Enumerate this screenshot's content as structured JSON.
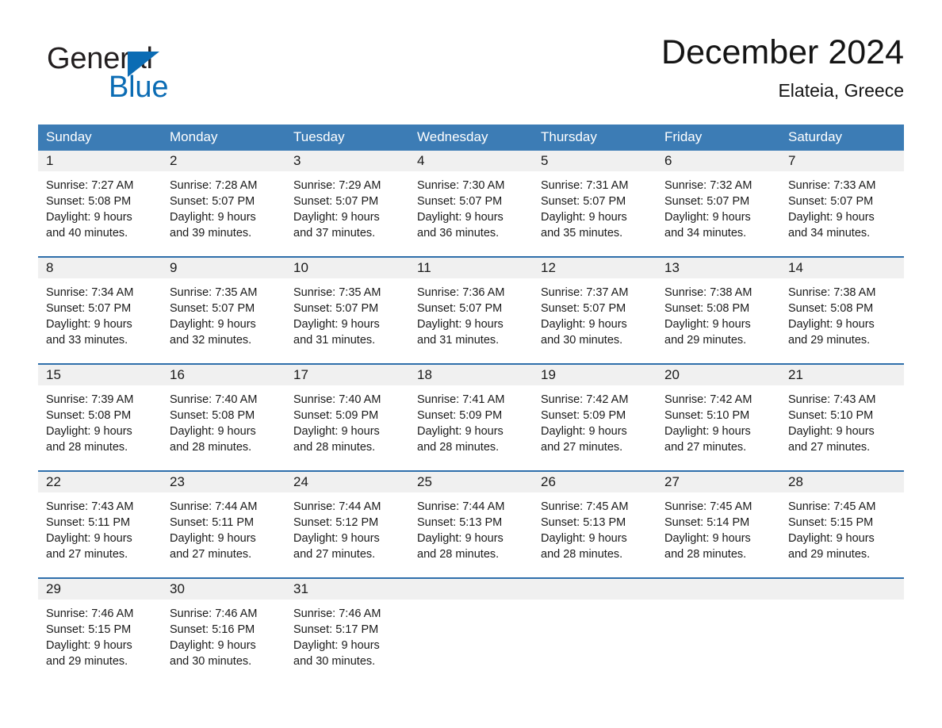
{
  "brand": {
    "name_part1": "General",
    "name_part2": "Blue",
    "accent_color": "#0b6cb4"
  },
  "header": {
    "month_title": "December 2024",
    "location": "Elateia, Greece"
  },
  "theme": {
    "header_row_color": "#3c7cb5",
    "week_separator_color": "#2f6fab",
    "daynum_band_color": "#f0f0f0",
    "page_background": "#ffffff"
  },
  "calendar": {
    "weekday_headers": [
      "Sunday",
      "Monday",
      "Tuesday",
      "Wednesday",
      "Thursday",
      "Friday",
      "Saturday"
    ],
    "weeks": [
      [
        {
          "day": "1",
          "sunrise": "Sunrise: 7:27 AM",
          "sunset": "Sunset: 5:08 PM",
          "daylight_line1": "Daylight: 9 hours",
          "daylight_line2": "and 40 minutes."
        },
        {
          "day": "2",
          "sunrise": "Sunrise: 7:28 AM",
          "sunset": "Sunset: 5:07 PM",
          "daylight_line1": "Daylight: 9 hours",
          "daylight_line2": "and 39 minutes."
        },
        {
          "day": "3",
          "sunrise": "Sunrise: 7:29 AM",
          "sunset": "Sunset: 5:07 PM",
          "daylight_line1": "Daylight: 9 hours",
          "daylight_line2": "and 37 minutes."
        },
        {
          "day": "4",
          "sunrise": "Sunrise: 7:30 AM",
          "sunset": "Sunset: 5:07 PM",
          "daylight_line1": "Daylight: 9 hours",
          "daylight_line2": "and 36 minutes."
        },
        {
          "day": "5",
          "sunrise": "Sunrise: 7:31 AM",
          "sunset": "Sunset: 5:07 PM",
          "daylight_line1": "Daylight: 9 hours",
          "daylight_line2": "and 35 minutes."
        },
        {
          "day": "6",
          "sunrise": "Sunrise: 7:32 AM",
          "sunset": "Sunset: 5:07 PM",
          "daylight_line1": "Daylight: 9 hours",
          "daylight_line2": "and 34 minutes."
        },
        {
          "day": "7",
          "sunrise": "Sunrise: 7:33 AM",
          "sunset": "Sunset: 5:07 PM",
          "daylight_line1": "Daylight: 9 hours",
          "daylight_line2": "and 34 minutes."
        }
      ],
      [
        {
          "day": "8",
          "sunrise": "Sunrise: 7:34 AM",
          "sunset": "Sunset: 5:07 PM",
          "daylight_line1": "Daylight: 9 hours",
          "daylight_line2": "and 33 minutes."
        },
        {
          "day": "9",
          "sunrise": "Sunrise: 7:35 AM",
          "sunset": "Sunset: 5:07 PM",
          "daylight_line1": "Daylight: 9 hours",
          "daylight_line2": "and 32 minutes."
        },
        {
          "day": "10",
          "sunrise": "Sunrise: 7:35 AM",
          "sunset": "Sunset: 5:07 PM",
          "daylight_line1": "Daylight: 9 hours",
          "daylight_line2": "and 31 minutes."
        },
        {
          "day": "11",
          "sunrise": "Sunrise: 7:36 AM",
          "sunset": "Sunset: 5:07 PM",
          "daylight_line1": "Daylight: 9 hours",
          "daylight_line2": "and 31 minutes."
        },
        {
          "day": "12",
          "sunrise": "Sunrise: 7:37 AM",
          "sunset": "Sunset: 5:07 PM",
          "daylight_line1": "Daylight: 9 hours",
          "daylight_line2": "and 30 minutes."
        },
        {
          "day": "13",
          "sunrise": "Sunrise: 7:38 AM",
          "sunset": "Sunset: 5:08 PM",
          "daylight_line1": "Daylight: 9 hours",
          "daylight_line2": "and 29 minutes."
        },
        {
          "day": "14",
          "sunrise": "Sunrise: 7:38 AM",
          "sunset": "Sunset: 5:08 PM",
          "daylight_line1": "Daylight: 9 hours",
          "daylight_line2": "and 29 minutes."
        }
      ],
      [
        {
          "day": "15",
          "sunrise": "Sunrise: 7:39 AM",
          "sunset": "Sunset: 5:08 PM",
          "daylight_line1": "Daylight: 9 hours",
          "daylight_line2": "and 28 minutes."
        },
        {
          "day": "16",
          "sunrise": "Sunrise: 7:40 AM",
          "sunset": "Sunset: 5:08 PM",
          "daylight_line1": "Daylight: 9 hours",
          "daylight_line2": "and 28 minutes."
        },
        {
          "day": "17",
          "sunrise": "Sunrise: 7:40 AM",
          "sunset": "Sunset: 5:09 PM",
          "daylight_line1": "Daylight: 9 hours",
          "daylight_line2": "and 28 minutes."
        },
        {
          "day": "18",
          "sunrise": "Sunrise: 7:41 AM",
          "sunset": "Sunset: 5:09 PM",
          "daylight_line1": "Daylight: 9 hours",
          "daylight_line2": "and 28 minutes."
        },
        {
          "day": "19",
          "sunrise": "Sunrise: 7:42 AM",
          "sunset": "Sunset: 5:09 PM",
          "daylight_line1": "Daylight: 9 hours",
          "daylight_line2": "and 27 minutes."
        },
        {
          "day": "20",
          "sunrise": "Sunrise: 7:42 AM",
          "sunset": "Sunset: 5:10 PM",
          "daylight_line1": "Daylight: 9 hours",
          "daylight_line2": "and 27 minutes."
        },
        {
          "day": "21",
          "sunrise": "Sunrise: 7:43 AM",
          "sunset": "Sunset: 5:10 PM",
          "daylight_line1": "Daylight: 9 hours",
          "daylight_line2": "and 27 minutes."
        }
      ],
      [
        {
          "day": "22",
          "sunrise": "Sunrise: 7:43 AM",
          "sunset": "Sunset: 5:11 PM",
          "daylight_line1": "Daylight: 9 hours",
          "daylight_line2": "and 27 minutes."
        },
        {
          "day": "23",
          "sunrise": "Sunrise: 7:44 AM",
          "sunset": "Sunset: 5:11 PM",
          "daylight_line1": "Daylight: 9 hours",
          "daylight_line2": "and 27 minutes."
        },
        {
          "day": "24",
          "sunrise": "Sunrise: 7:44 AM",
          "sunset": "Sunset: 5:12 PM",
          "daylight_line1": "Daylight: 9 hours",
          "daylight_line2": "and 27 minutes."
        },
        {
          "day": "25",
          "sunrise": "Sunrise: 7:44 AM",
          "sunset": "Sunset: 5:13 PM",
          "daylight_line1": "Daylight: 9 hours",
          "daylight_line2": "and 28 minutes."
        },
        {
          "day": "26",
          "sunrise": "Sunrise: 7:45 AM",
          "sunset": "Sunset: 5:13 PM",
          "daylight_line1": "Daylight: 9 hours",
          "daylight_line2": "and 28 minutes."
        },
        {
          "day": "27",
          "sunrise": "Sunrise: 7:45 AM",
          "sunset": "Sunset: 5:14 PM",
          "daylight_line1": "Daylight: 9 hours",
          "daylight_line2": "and 28 minutes."
        },
        {
          "day": "28",
          "sunrise": "Sunrise: 7:45 AM",
          "sunset": "Sunset: 5:15 PM",
          "daylight_line1": "Daylight: 9 hours",
          "daylight_line2": "and 29 minutes."
        }
      ],
      [
        {
          "day": "29",
          "sunrise": "Sunrise: 7:46 AM",
          "sunset": "Sunset: 5:15 PM",
          "daylight_line1": "Daylight: 9 hours",
          "daylight_line2": "and 29 minutes."
        },
        {
          "day": "30",
          "sunrise": "Sunrise: 7:46 AM",
          "sunset": "Sunset: 5:16 PM",
          "daylight_line1": "Daylight: 9 hours",
          "daylight_line2": "and 30 minutes."
        },
        {
          "day": "31",
          "sunrise": "Sunrise: 7:46 AM",
          "sunset": "Sunset: 5:17 PM",
          "daylight_line1": "Daylight: 9 hours",
          "daylight_line2": "and 30 minutes."
        },
        {
          "day": "",
          "sunrise": "",
          "sunset": "",
          "daylight_line1": "",
          "daylight_line2": ""
        },
        {
          "day": "",
          "sunrise": "",
          "sunset": "",
          "daylight_line1": "",
          "daylight_line2": ""
        },
        {
          "day": "",
          "sunrise": "",
          "sunset": "",
          "daylight_line1": "",
          "daylight_line2": ""
        },
        {
          "day": "",
          "sunrise": "",
          "sunset": "",
          "daylight_line1": "",
          "daylight_line2": ""
        }
      ]
    ]
  }
}
